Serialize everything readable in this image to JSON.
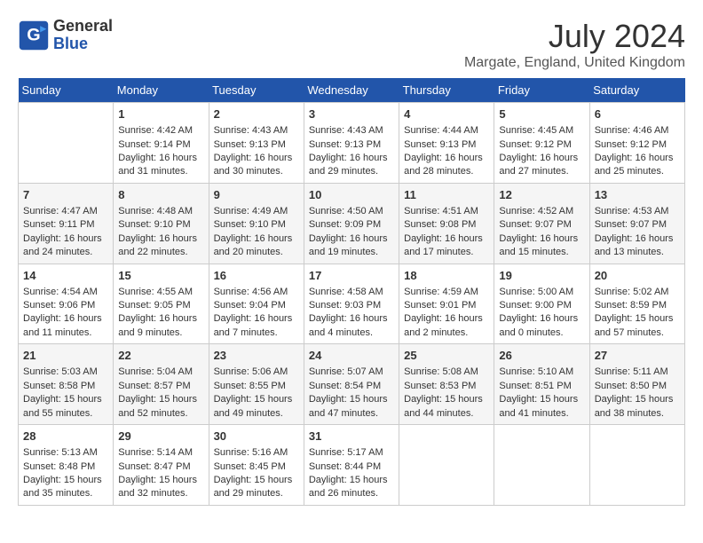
{
  "header": {
    "logo_general": "General",
    "logo_blue": "Blue",
    "month_year": "July 2024",
    "location": "Margate, England, United Kingdom"
  },
  "weekdays": [
    "Sunday",
    "Monday",
    "Tuesday",
    "Wednesday",
    "Thursday",
    "Friday",
    "Saturday"
  ],
  "weeks": [
    [
      {
        "day": "",
        "info": ""
      },
      {
        "day": "1",
        "info": "Sunrise: 4:42 AM\nSunset: 9:14 PM\nDaylight: 16 hours\nand 31 minutes."
      },
      {
        "day": "2",
        "info": "Sunrise: 4:43 AM\nSunset: 9:13 PM\nDaylight: 16 hours\nand 30 minutes."
      },
      {
        "day": "3",
        "info": "Sunrise: 4:43 AM\nSunset: 9:13 PM\nDaylight: 16 hours\nand 29 minutes."
      },
      {
        "day": "4",
        "info": "Sunrise: 4:44 AM\nSunset: 9:13 PM\nDaylight: 16 hours\nand 28 minutes."
      },
      {
        "day": "5",
        "info": "Sunrise: 4:45 AM\nSunset: 9:12 PM\nDaylight: 16 hours\nand 27 minutes."
      },
      {
        "day": "6",
        "info": "Sunrise: 4:46 AM\nSunset: 9:12 PM\nDaylight: 16 hours\nand 25 minutes."
      }
    ],
    [
      {
        "day": "7",
        "info": "Sunrise: 4:47 AM\nSunset: 9:11 PM\nDaylight: 16 hours\nand 24 minutes."
      },
      {
        "day": "8",
        "info": "Sunrise: 4:48 AM\nSunset: 9:10 PM\nDaylight: 16 hours\nand 22 minutes."
      },
      {
        "day": "9",
        "info": "Sunrise: 4:49 AM\nSunset: 9:10 PM\nDaylight: 16 hours\nand 20 minutes."
      },
      {
        "day": "10",
        "info": "Sunrise: 4:50 AM\nSunset: 9:09 PM\nDaylight: 16 hours\nand 19 minutes."
      },
      {
        "day": "11",
        "info": "Sunrise: 4:51 AM\nSunset: 9:08 PM\nDaylight: 16 hours\nand 17 minutes."
      },
      {
        "day": "12",
        "info": "Sunrise: 4:52 AM\nSunset: 9:07 PM\nDaylight: 16 hours\nand 15 minutes."
      },
      {
        "day": "13",
        "info": "Sunrise: 4:53 AM\nSunset: 9:07 PM\nDaylight: 16 hours\nand 13 minutes."
      }
    ],
    [
      {
        "day": "14",
        "info": "Sunrise: 4:54 AM\nSunset: 9:06 PM\nDaylight: 16 hours\nand 11 minutes."
      },
      {
        "day": "15",
        "info": "Sunrise: 4:55 AM\nSunset: 9:05 PM\nDaylight: 16 hours\nand 9 minutes."
      },
      {
        "day": "16",
        "info": "Sunrise: 4:56 AM\nSunset: 9:04 PM\nDaylight: 16 hours\nand 7 minutes."
      },
      {
        "day": "17",
        "info": "Sunrise: 4:58 AM\nSunset: 9:03 PM\nDaylight: 16 hours\nand 4 minutes."
      },
      {
        "day": "18",
        "info": "Sunrise: 4:59 AM\nSunset: 9:01 PM\nDaylight: 16 hours\nand 2 minutes."
      },
      {
        "day": "19",
        "info": "Sunrise: 5:00 AM\nSunset: 9:00 PM\nDaylight: 16 hours\nand 0 minutes."
      },
      {
        "day": "20",
        "info": "Sunrise: 5:02 AM\nSunset: 8:59 PM\nDaylight: 15 hours\nand 57 minutes."
      }
    ],
    [
      {
        "day": "21",
        "info": "Sunrise: 5:03 AM\nSunset: 8:58 PM\nDaylight: 15 hours\nand 55 minutes."
      },
      {
        "day": "22",
        "info": "Sunrise: 5:04 AM\nSunset: 8:57 PM\nDaylight: 15 hours\nand 52 minutes."
      },
      {
        "day": "23",
        "info": "Sunrise: 5:06 AM\nSunset: 8:55 PM\nDaylight: 15 hours\nand 49 minutes."
      },
      {
        "day": "24",
        "info": "Sunrise: 5:07 AM\nSunset: 8:54 PM\nDaylight: 15 hours\nand 47 minutes."
      },
      {
        "day": "25",
        "info": "Sunrise: 5:08 AM\nSunset: 8:53 PM\nDaylight: 15 hours\nand 44 minutes."
      },
      {
        "day": "26",
        "info": "Sunrise: 5:10 AM\nSunset: 8:51 PM\nDaylight: 15 hours\nand 41 minutes."
      },
      {
        "day": "27",
        "info": "Sunrise: 5:11 AM\nSunset: 8:50 PM\nDaylight: 15 hours\nand 38 minutes."
      }
    ],
    [
      {
        "day": "28",
        "info": "Sunrise: 5:13 AM\nSunset: 8:48 PM\nDaylight: 15 hours\nand 35 minutes."
      },
      {
        "day": "29",
        "info": "Sunrise: 5:14 AM\nSunset: 8:47 PM\nDaylight: 15 hours\nand 32 minutes."
      },
      {
        "day": "30",
        "info": "Sunrise: 5:16 AM\nSunset: 8:45 PM\nDaylight: 15 hours\nand 29 minutes."
      },
      {
        "day": "31",
        "info": "Sunrise: 5:17 AM\nSunset: 8:44 PM\nDaylight: 15 hours\nand 26 minutes."
      },
      {
        "day": "",
        "info": ""
      },
      {
        "day": "",
        "info": ""
      },
      {
        "day": "",
        "info": ""
      }
    ]
  ]
}
